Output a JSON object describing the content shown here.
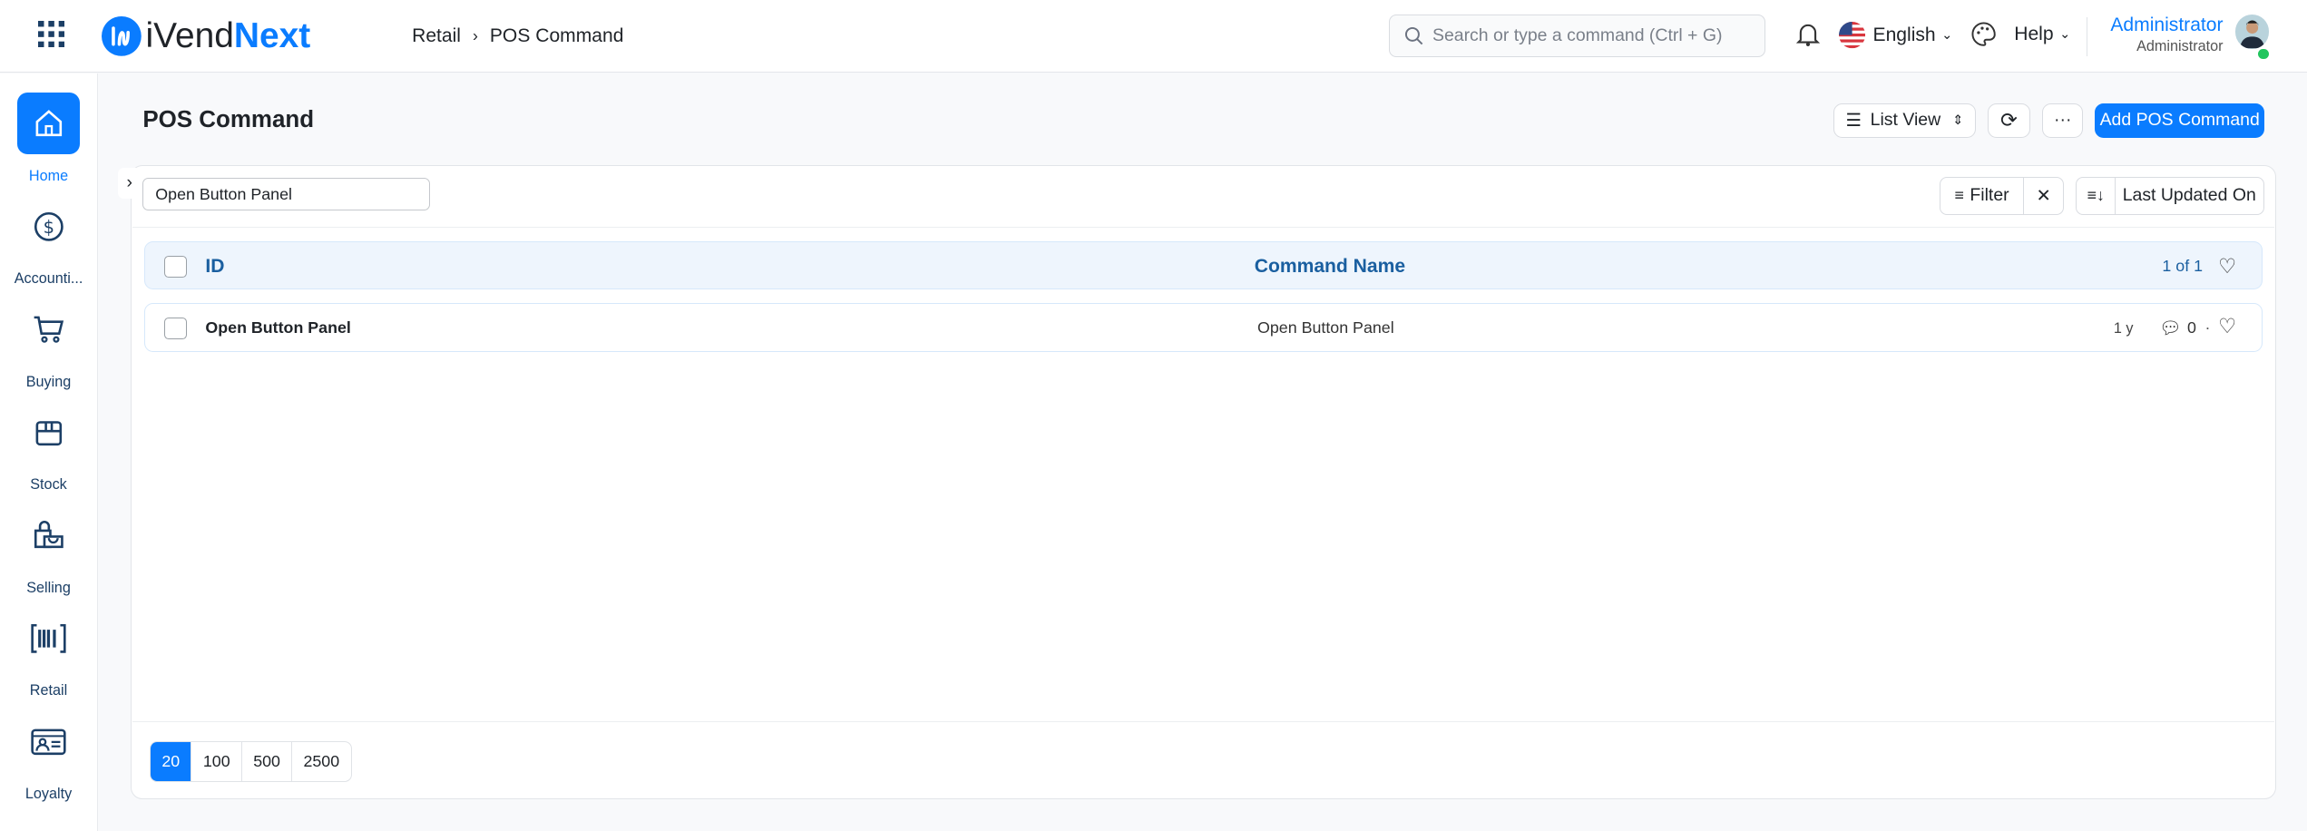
{
  "header": {
    "app_name_part1": "iVend",
    "app_name_part2": "Next",
    "breadcrumb": [
      "Retail",
      "POS Command"
    ],
    "search_placeholder": "Search or type a command (Ctrl + G)",
    "language": "English",
    "help": "Help",
    "user_name": "Administrator",
    "user_role": "Administrator"
  },
  "sidebar": {
    "items": [
      {
        "label": "Home",
        "icon": "home-icon",
        "active": true
      },
      {
        "label": "Accounti...",
        "icon": "dollar-icon"
      },
      {
        "label": "Buying",
        "icon": "cart-icon"
      },
      {
        "label": "Stock",
        "icon": "box-icon"
      },
      {
        "label": "Selling",
        "icon": "shopping-bag-icon"
      },
      {
        "label": "Retail",
        "icon": "barcode-icon"
      },
      {
        "label": "Loyalty",
        "icon": "id-card-icon"
      }
    ]
  },
  "page": {
    "title": "POS Command",
    "list_view_label": "List View",
    "more_label": "···",
    "add_label": "Add POS Command"
  },
  "filters": {
    "name_filter_value": "Open Button Panel",
    "filter_label": "Filter",
    "sort_label": "Last Updated On"
  },
  "table": {
    "columns": [
      "ID",
      "Command Name"
    ],
    "count": "1 of 1",
    "rows": [
      {
        "id": "Open Button Panel",
        "command_name": "Open Button Panel",
        "modified": "1 y",
        "comments": "0"
      }
    ]
  },
  "paging": [
    "20",
    "100",
    "500",
    "2500"
  ],
  "colors": {
    "accent": "#0a7cff",
    "nav": "#1c3f66",
    "header_row_bg": "#eef5fd"
  }
}
